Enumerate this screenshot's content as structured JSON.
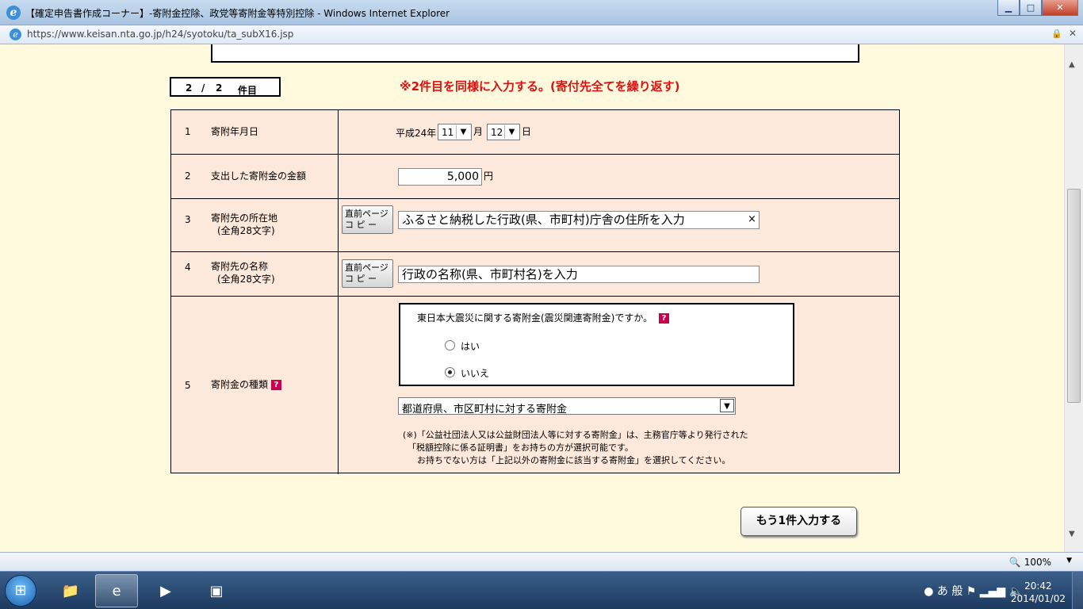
{
  "window": {
    "title": "【確定申告書作成コーナー】-寄附金控除、政党等寄附金等特別控除 - Windows Internet Explorer",
    "minimize": "▁",
    "maximize": "□",
    "close": "✕"
  },
  "address": {
    "url": "https://www.keisan.nta.go.jp/h24/syotoku/ta_subX16.jsp"
  },
  "page": {
    "count_current": "2",
    "count_sep": "/",
    "count_total": "2",
    "count_suffix": "件目",
    "notice": "※2件目を同様に入力する。(寄付先全てを繰り返す)"
  },
  "rows": {
    "r1": {
      "num": "1",
      "label": "寄附年月日",
      "era": "平成24年",
      "month": "11",
      "month_unit": "月",
      "day": "12",
      "day_unit": "日"
    },
    "r2": {
      "num": "2",
      "label": "支出した寄附金の金額",
      "amount": "5,000",
      "unit": "円"
    },
    "r3": {
      "num": "3",
      "label": "寄附先の所在地",
      "sublabel": "(全角28文字)",
      "copy_line1": "直前ページ",
      "copy_line2": "コ ピ ー",
      "value": "ふるさと納税した行政(県、市町村)庁舎の住所を入力",
      "clear": "×"
    },
    "r4": {
      "num": "4",
      "label": "寄附先の名称",
      "sublabel": "(全角28文字)",
      "copy_line1": "直前ページ",
      "copy_line2": "コ ピ ー",
      "value": "行政の名称(県、市町村名)を入力"
    },
    "r5": {
      "num": "5",
      "label": "寄附金の種類",
      "question": "東日本大震災に関する寄附金(震災関連寄附金)ですか。",
      "opt_yes": "はい",
      "opt_no": "いいえ",
      "selected": "いいえ",
      "select_value": "都道府県、市区町村に対する寄附金",
      "note1": "(※)「公益社団法人又は公益財団法人等に対する寄附金」は、主務官庁等より発行された",
      "note2": "「税額控除に係る証明書」をお持ちの方が選択可能です。",
      "note3": "お持ちでない方は「上記以外の寄附金に該当する寄附金」を選択してください。"
    }
  },
  "buttons": {
    "more": "もう1件入力する"
  },
  "status": {
    "zoom": "100%"
  },
  "taskbar": {
    "ime_a": "あ",
    "ime_mode": "般",
    "time": "20:42",
    "date": "2014/01/02"
  },
  "icons": {
    "help": "?",
    "dropdown": "▼"
  }
}
